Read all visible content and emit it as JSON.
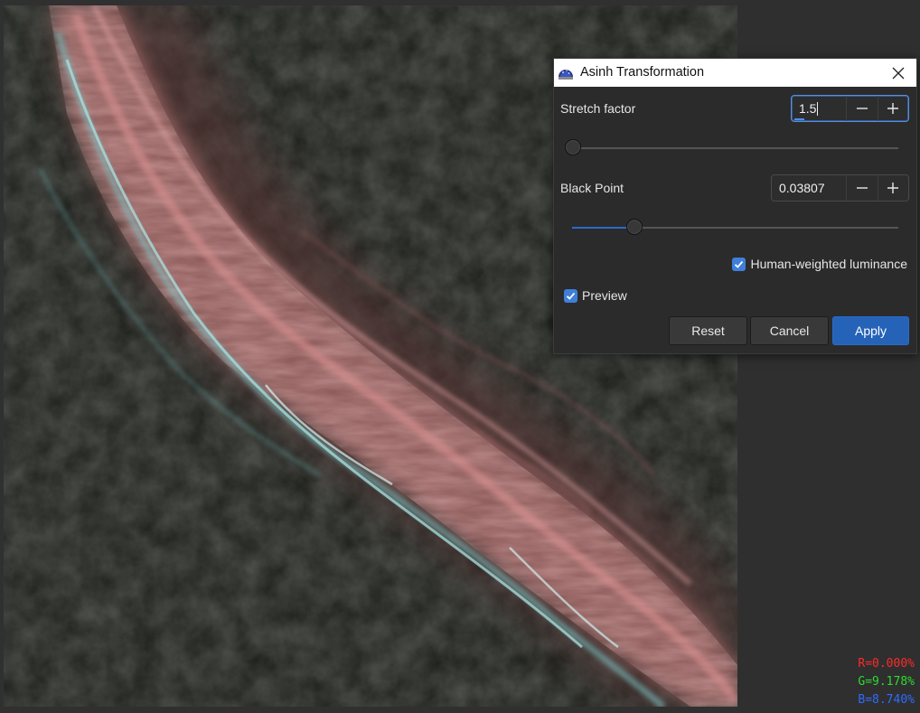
{
  "dialog": {
    "title": "Asinh Transformation",
    "stretch": {
      "label": "Stretch factor",
      "value": "1.5",
      "slider_fraction": 0.0
    },
    "black_point": {
      "label": "Black Point",
      "value": "0.03807",
      "slider_fraction": 0.19
    },
    "human_weighted": {
      "label": "Human-weighted luminance",
      "checked": true
    },
    "preview": {
      "label": "Preview",
      "checked": true
    },
    "buttons": {
      "reset": "Reset",
      "cancel": "Cancel",
      "apply": "Apply"
    }
  },
  "pixel_readout": {
    "r": "R=0.000%",
    "g": "G=9.178%",
    "b": "B=8.740%"
  },
  "colors": {
    "accent": "#2563b8",
    "readout_r": "#ff2a2a",
    "readout_g": "#2ddc2d",
    "readout_b": "#2f6cff"
  },
  "icons": {
    "app": "siril-observatory-icon",
    "close": "close-icon",
    "decrement": "minus-icon",
    "increment": "plus-icon",
    "check": "checkmark-icon"
  }
}
